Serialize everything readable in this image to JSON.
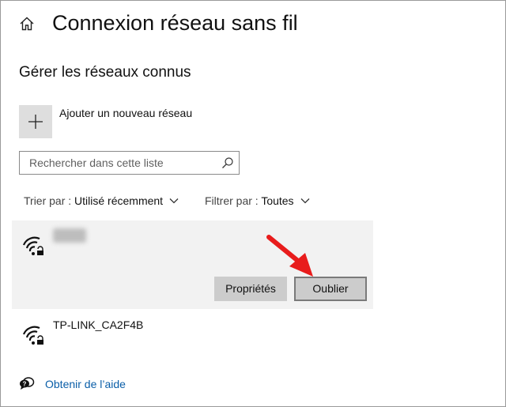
{
  "header": {
    "title": "Connexion réseau sans fil",
    "home_icon": "home-icon"
  },
  "known_networks": {
    "section_title": "Gérer les réseaux connus",
    "add_network_label": "Ajouter un nouveau réseau",
    "add_icon": "plus-icon",
    "search": {
      "placeholder": "Rechercher dans cette liste",
      "value": "",
      "icon": "search-icon"
    },
    "sort": {
      "label": "Trier par : ",
      "value": "Utilisé récemment"
    },
    "filter": {
      "label": "Filtrer par : ",
      "value": "Toutes"
    },
    "networks": [
      {
        "name": "lamat",
        "name_blurred": true,
        "icon": "wifi-secured-icon",
        "selected": true,
        "actions": {
          "properties_label": "Propriétés",
          "forget_label": "Oublier"
        }
      },
      {
        "name": "TP-LINK_CA2F4B",
        "icon": "wifi-secured-icon",
        "selected": false
      }
    ]
  },
  "help": {
    "label": "Obtenir de l’aide",
    "icon": "help-chat-icon"
  },
  "annotation": {
    "arrow_color": "#e81c1c",
    "points_to": "forget-button"
  },
  "colors": {
    "selected_row_bg": "#f2f2f2",
    "button_bg": "#cccccc",
    "link": "#0a5ea8"
  }
}
